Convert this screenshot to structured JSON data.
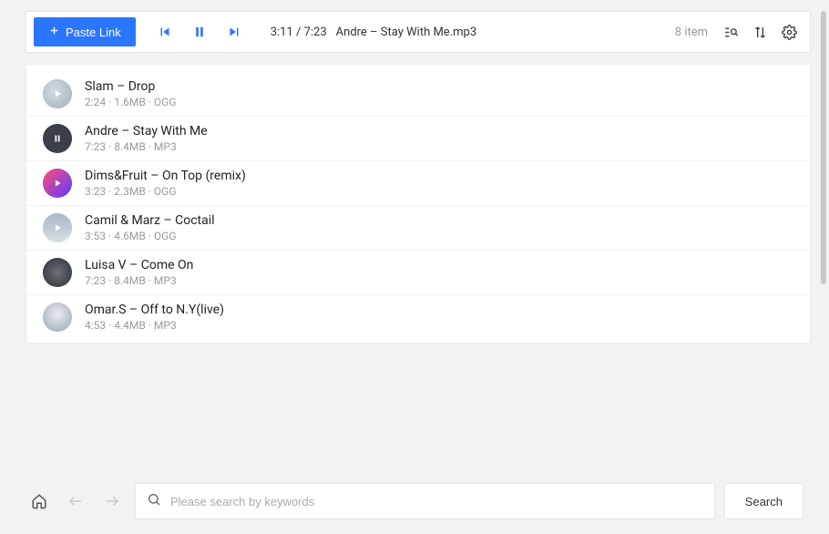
{
  "toolbar": {
    "paste_label": "Paste Link",
    "time": "3:11 / 7:23",
    "now_playing": "Andre – Stay With Me.mp3",
    "item_count": "8 item"
  },
  "tracks": [
    {
      "title": "Slam – Drop",
      "meta": "2:24 · 1.6MB · OGG",
      "icon": "play",
      "bg": "radial-gradient(circle at 40% 40%, #d4dbe0, #9fb0bc)"
    },
    {
      "title": "Andre – Stay With Me",
      "meta": "7:23 · 8.4MB · MP3",
      "icon": "pause",
      "bg": "#3b3f47"
    },
    {
      "title": "Dims&Fruit – On Top (remix)",
      "meta": "3:23 · 2.3MB · OGG",
      "icon": "play",
      "bg": "linear-gradient(135deg, #ff4d79, #5a3cff)"
    },
    {
      "title": "Camil & Marz – Coctail",
      "meta": "3:53 · 4.6MB · OGG",
      "icon": "play",
      "bg": "linear-gradient(180deg, #a9b8c7, #d8dee5)"
    },
    {
      "title": "Luisa V – Come On",
      "meta": "7:23 · 8.4MB · MP3",
      "icon": "none",
      "bg": "radial-gradient(circle, #6b7178, #2c2f33)"
    },
    {
      "title": "Omar.S – Off to N.Y(live)",
      "meta": "4:53 · 4.4MB · MP3",
      "icon": "none",
      "bg": "radial-gradient(circle at 50% 40%, #e8ecef, #9aa6b0)"
    }
  ],
  "search": {
    "placeholder": "Please search by keywords",
    "button": "Search"
  }
}
